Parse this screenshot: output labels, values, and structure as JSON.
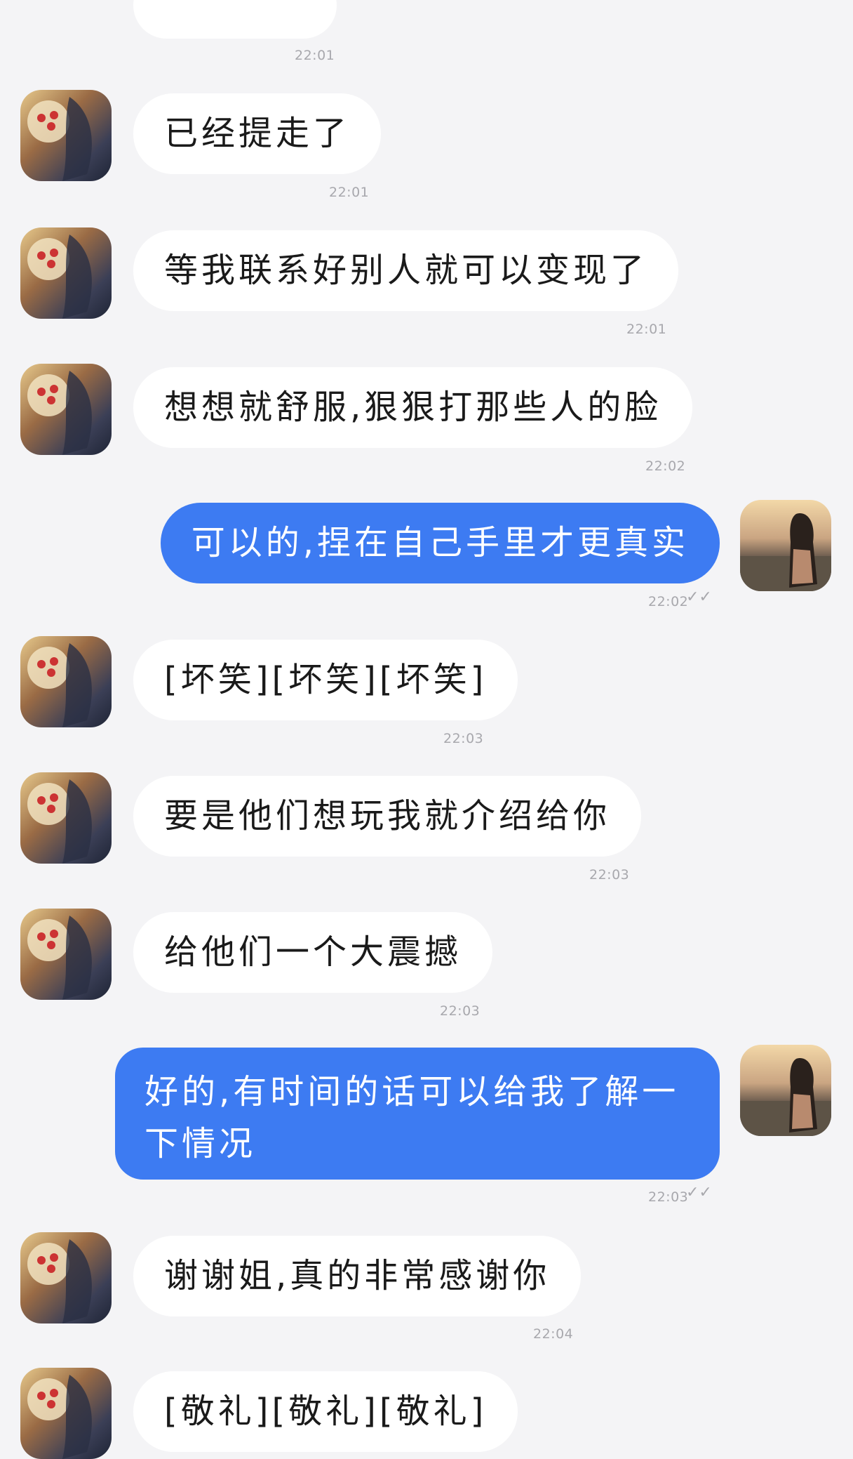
{
  "messages": [
    {
      "side": "them",
      "text": "",
      "time": "22:01"
    },
    {
      "side": "them",
      "text": "已经提走了",
      "time": "22:01"
    },
    {
      "side": "them",
      "text": "等我联系好别人就可以变现了",
      "time": "22:01"
    },
    {
      "side": "them",
      "text": "想想就舒服,狠狠打那些人的脸",
      "time": "22:02"
    },
    {
      "side": "me",
      "text": "可以的,捏在自己手里才更真实",
      "time": "22:02"
    },
    {
      "side": "them",
      "text": "[坏笑][坏笑][坏笑]",
      "time": "22:03"
    },
    {
      "side": "them",
      "text": "要是他们想玩我就介绍给你",
      "time": "22:03"
    },
    {
      "side": "them",
      "text": "给他们一个大震撼",
      "time": "22:03"
    },
    {
      "side": "me",
      "text": "好的,有时间的话可以给我了解一下情况",
      "time": "22:03"
    },
    {
      "side": "them",
      "text": "谢谢姐,真的非常感谢你",
      "time": "22:04"
    },
    {
      "side": "them",
      "text": "[敬礼][敬礼][敬礼]",
      "time": ""
    }
  ],
  "read_receipt_icon": "double-check-icon",
  "colors": {
    "sent_bubble": "#3d7bf2",
    "received_bubble": "#ffffff",
    "background": "#f4f4f6",
    "timestamp": "#a8a8ad"
  }
}
